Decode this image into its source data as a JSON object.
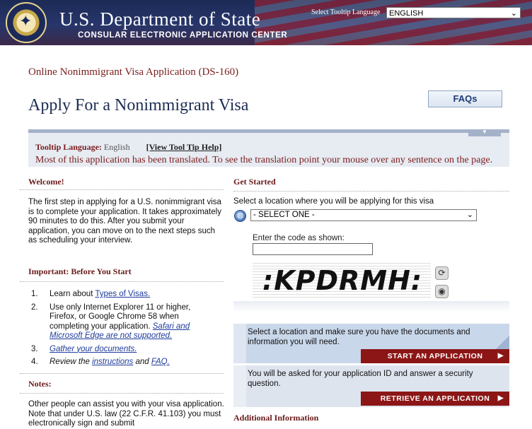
{
  "header": {
    "title": "U.S. Department of State",
    "subtitle": "CONSULAR ELECTRONIC APPLICATION CENTER",
    "tooltip_language_label": "Select Tooltip Language",
    "tooltip_language_value": "ENGLISH"
  },
  "page": {
    "app_name": "Online Nonimmigrant Visa Application (DS-160)",
    "heading": "Apply For a Nonimmigrant Visa",
    "faqs_label": "FAQs"
  },
  "tooltip_bar": {
    "label": "Tooltip Language:",
    "value": "English",
    "link": "[View Tool Tip Help]",
    "message": "Most of this application has been translated. To see the translation point your mouse over any sentence on the page."
  },
  "left": {
    "welcome_heading": "Welcome!",
    "welcome_text": "The first step in applying for a U.S. nonimmigrant visa is to complete your application. It takes approximately 90 minutes to do this. After you submit your application, you can move on to the next steps such as scheduling your interview.",
    "important_heading": "Important: Before You Start",
    "list": {
      "n1": "1.",
      "i1_pre": "Learn about ",
      "i1_link": "Types of Visas.",
      "n2": "2.",
      "i2_text": "Use only Internet Explorer 11 or higher, Firefox, or Google Chrome 58 when completing your application. ",
      "i2_link": "Safari and Microsoft Edge are not supported.",
      "n3": "3.",
      "i3_link": "Gather your documents.",
      "n4": "4.",
      "i4_pre": "Review the ",
      "i4_link1": "instructions",
      "i4_mid": " and ",
      "i4_link2": "FAQ."
    },
    "notes_heading": "Notes:",
    "notes_text": "Other people can assist you with your visa application. Note that under U.S. law (22 C.F.R. 41.103) you must electronically sign and submit"
  },
  "right": {
    "get_started_heading": "Get Started",
    "location_label": "Select a location where you will be applying for this visa",
    "location_value": "- SELECT ONE -",
    "code_label": "Enter the code as shown:",
    "captcha_text": ":KPDRMH:",
    "start_text": "Select a location and make sure you have the documents and information you will need.",
    "start_button": "START AN APPLICATION",
    "retrieve_text": "You will be asked for your application ID and answer a security question.",
    "retrieve_button": "RETRIEVE AN APPLICATION",
    "additional_heading": "Additional Information"
  },
  "colors": {
    "brand_red": "#8c1616",
    "navy": "#1d2d52",
    "accent_blue": "#c9d7ea"
  },
  "icons": [
    "seal-logo",
    "globe-icon",
    "refresh-icon",
    "audio-icon",
    "chevron-down-icon",
    "arrow-right-icon"
  ]
}
